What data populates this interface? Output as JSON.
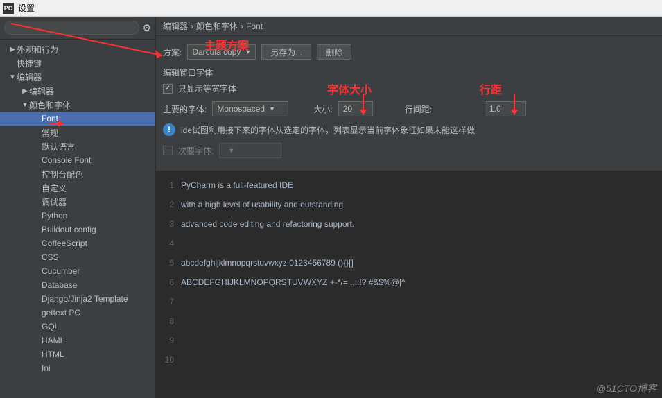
{
  "window": {
    "icon": "PC",
    "title": "设置"
  },
  "search": {
    "placeholder": ""
  },
  "tree": {
    "items": [
      {
        "label": "外观和行为",
        "level": 1,
        "arrow": "▶"
      },
      {
        "label": "快捷键",
        "level": 1,
        "arrow": ""
      },
      {
        "label": "编辑器",
        "level": 1,
        "arrow": "▼"
      },
      {
        "label": "编辑器",
        "level": 2,
        "arrow": "▶"
      },
      {
        "label": "颜色和字体",
        "level": 2,
        "arrow": "▼"
      },
      {
        "label": "Font",
        "level": 3,
        "arrow": "",
        "selected": true
      },
      {
        "label": "常规",
        "level": 3,
        "arrow": ""
      },
      {
        "label": "默认语言",
        "level": 3,
        "arrow": ""
      },
      {
        "label": "Console Font",
        "level": 3,
        "arrow": ""
      },
      {
        "label": "控制台配色",
        "level": 3,
        "arrow": ""
      },
      {
        "label": "自定义",
        "level": 3,
        "arrow": ""
      },
      {
        "label": "调试器",
        "level": 3,
        "arrow": ""
      },
      {
        "label": "Python",
        "level": 3,
        "arrow": ""
      },
      {
        "label": "Buildout config",
        "level": 3,
        "arrow": ""
      },
      {
        "label": "CoffeeScript",
        "level": 3,
        "arrow": ""
      },
      {
        "label": "CSS",
        "level": 3,
        "arrow": ""
      },
      {
        "label": "Cucumber",
        "level": 3,
        "arrow": ""
      },
      {
        "label": "Database",
        "level": 3,
        "arrow": ""
      },
      {
        "label": "Django/Jinja2 Template",
        "level": 3,
        "arrow": ""
      },
      {
        "label": "gettext PO",
        "level": 3,
        "arrow": ""
      },
      {
        "label": "GQL",
        "level": 3,
        "arrow": ""
      },
      {
        "label": "HAML",
        "level": 3,
        "arrow": ""
      },
      {
        "label": "HTML",
        "level": 3,
        "arrow": ""
      },
      {
        "label": "Ini",
        "level": 3,
        "arrow": ""
      }
    ]
  },
  "breadcrumb": {
    "a": "编辑器",
    "b": "颜色和字体",
    "c": "Font"
  },
  "form": {
    "scheme_label": "方案:",
    "scheme_value": "Darcula copy",
    "save_as": "另存为...",
    "delete": "删除",
    "editor_font_title": "编辑窗口字体",
    "mono_only": "只显示等宽字体",
    "primary_font_label": "主要的字体:",
    "primary_font_value": "Monospaced",
    "size_label": "大小:",
    "size_value": "20",
    "line_spacing_label": "行间距:",
    "line_spacing_value": "1.0",
    "info_text": "ide试图利用接下来的字体从选定的字体，列表显示当前字体象征如果未能这样做",
    "secondary_font_label": "次要字体:"
  },
  "preview": {
    "lines": [
      "PyCharm is a full-featured IDE",
      "with a high level of usability and outstanding",
      "advanced code editing and refactoring support.",
      "",
      "abcdefghijklmnopqrstuvwxyz 0123456789 (){}[]",
      "ABCDEFGHIJKLMNOPQRSTUVWXYZ +-*/= .,;:!? #&$%@|^",
      "",
      "",
      "",
      ""
    ]
  },
  "annotations": {
    "theme": "主题方案",
    "font_size": "字体大小",
    "line_space": "行距"
  },
  "watermark": "@51CTO博客"
}
